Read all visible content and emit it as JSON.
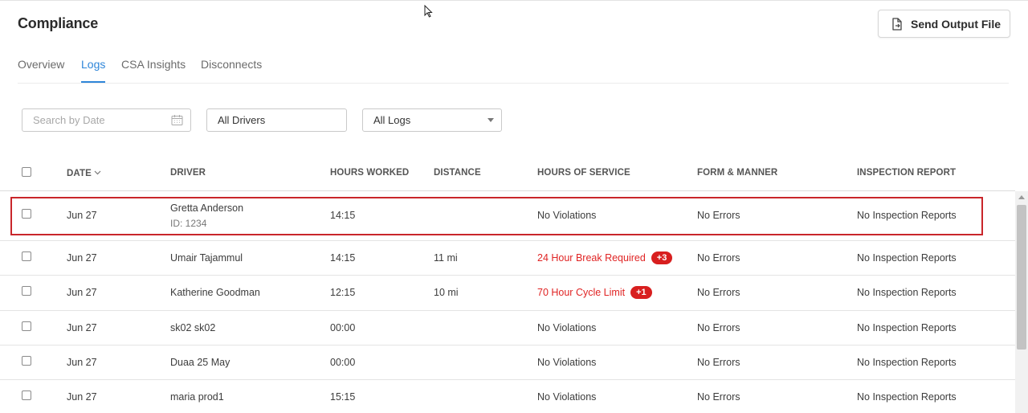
{
  "header": {
    "title": "Compliance",
    "send_button_label": "Send Output File",
    "send_button_icon": "file-export-icon"
  },
  "tabs": [
    {
      "label": "Overview",
      "active": false
    },
    {
      "label": "Logs",
      "active": true
    },
    {
      "label": "CSA Insights",
      "active": false
    },
    {
      "label": "Disconnects",
      "active": false
    }
  ],
  "filters": {
    "search_placeholder": "Search by Date",
    "drivers_value": "All Drivers",
    "logs_value": "All Logs"
  },
  "table": {
    "columns": [
      "DATE",
      "DRIVER",
      "HOURS WORKED",
      "DISTANCE",
      "HOURS OF SERVICE",
      "FORM & MANNER",
      "INSPECTION REPORT"
    ],
    "rows": [
      {
        "date": "Jun 27",
        "driver": "Gretta Anderson",
        "driver_id": "ID: 1234",
        "hours": "14:15",
        "distance": "",
        "hos": "No Violations",
        "hos_badge": "",
        "form": "No Errors",
        "inspection": "No Inspection Reports"
      },
      {
        "date": "Jun 27",
        "driver": "Umair Tajammul",
        "driver_id": "",
        "hours": "14:15",
        "distance": "11 mi",
        "hos": "24 Hour Break Required",
        "hos_badge": "+3",
        "form": "No Errors",
        "inspection": "No Inspection Reports"
      },
      {
        "date": "Jun 27",
        "driver": "Katherine Goodman",
        "driver_id": "",
        "hours": "12:15",
        "distance": "10 mi",
        "hos": "70 Hour Cycle Limit",
        "hos_badge": "+1",
        "form": "No Errors",
        "inspection": "No Inspection Reports"
      },
      {
        "date": "Jun 27",
        "driver": "sk02 sk02",
        "driver_id": "",
        "hours": "00:00",
        "distance": "",
        "hos": "No Violations",
        "hos_badge": "",
        "form": "No Errors",
        "inspection": "No Inspection Reports"
      },
      {
        "date": "Jun 27",
        "driver": "Duaa 25 May",
        "driver_id": "",
        "hours": "00:00",
        "distance": "",
        "hos": "No Violations",
        "hos_badge": "",
        "form": "No Errors",
        "inspection": "No Inspection Reports"
      },
      {
        "date": "Jun 27",
        "driver": "maria prod1",
        "driver_id": "",
        "hours": "15:15",
        "distance": "",
        "hos": "No Violations",
        "hos_badge": "",
        "form": "No Errors",
        "inspection": "No Inspection Reports"
      }
    ]
  },
  "colors": {
    "accent": "#2f86d9",
    "violation": "#e02424",
    "badge": "#d81f1f",
    "highlight": "#c9262b"
  }
}
